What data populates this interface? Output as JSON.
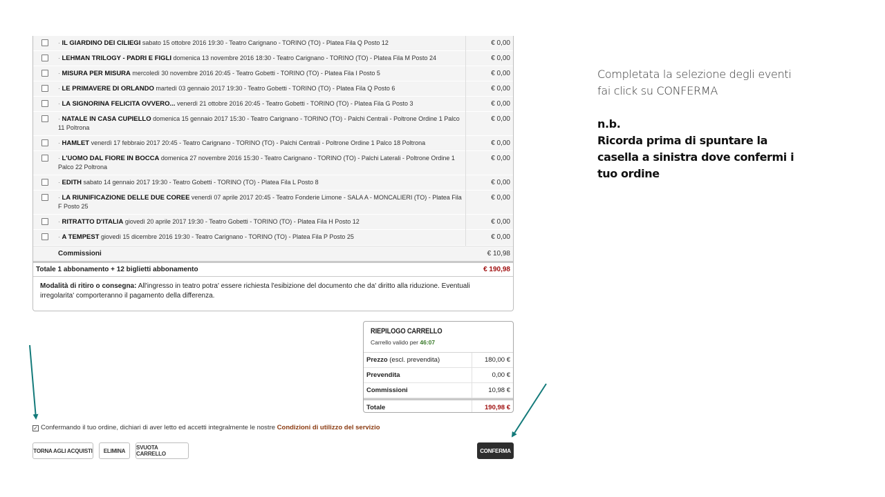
{
  "order": {
    "rows": [
      {
        "title": "IL GIARDINO DEI CILIEGI",
        "detail": "sabato 15 ottobre 2016 19:30 - Teatro Carignano - TORINO (TO) - Platea Fila Q Posto 12",
        "price": "€ 0,00"
      },
      {
        "title": "LEHMAN TRILOGY - PADRI E FIGLI",
        "detail": "domenica 13 novembre 2016 18:30 - Teatro Carignano - TORINO (TO) - Platea Fila M Posto 24",
        "price": "€ 0,00"
      },
      {
        "title": "MISURA PER MISURA",
        "detail": "mercoledì 30 novembre 2016 20:45 - Teatro Gobetti - TORINO (TO) - Platea Fila I Posto 5",
        "price": "€ 0,00"
      },
      {
        "title": "LE PRIMAVERE DI ORLANDO",
        "detail": "martedì 03 gennaio 2017 19:30 - Teatro Gobetti - TORINO (TO) - Platea Fila Q Posto 6",
        "price": "€ 0,00"
      },
      {
        "title": "LA SIGNORINA FELICITA OVVERO...",
        "detail": "venerdì 21 ottobre 2016 20:45 - Teatro Gobetti - TORINO (TO) - Platea Fila G Posto 3",
        "price": "€ 0,00"
      },
      {
        "title": "NATALE IN CASA CUPIELLO",
        "detail": "domenica 15 gennaio 2017 15:30 - Teatro Carignano - TORINO (TO) - Palchi Centrali - Poltrone Ordine 1 Palco 11 Poltrona",
        "price": "€ 0,00"
      },
      {
        "title": "HAMLET",
        "detail": "venerdì 17 febbraio 2017 20:45 - Teatro Carignano - TORINO (TO) - Palchi Centrali - Poltrone Ordine 1 Palco 18 Poltrona",
        "price": "€ 0,00"
      },
      {
        "title": "L'UOMO DAL FIORE IN BOCCA",
        "detail": "domenica 27 novembre 2016 15:30 - Teatro Carignano - TORINO (TO) - Palchi Laterali - Poltrone Ordine 1 Palco 22 Poltrona",
        "price": "€ 0,00"
      },
      {
        "title": "EDITH",
        "detail": "sabato 14 gennaio 2017 19:30 - Teatro Gobetti - TORINO (TO) - Platea Fila L Posto 8",
        "price": "€ 0,00"
      },
      {
        "title": "LA RIUNIFICAZIONE DELLE DUE COREE",
        "detail": "venerdì 07 aprile 2017 20:45 - Teatro Fonderie Limone - SALA A - MONCALIERI (TO) - Platea Fila F Posto 25",
        "price": "€ 0,00"
      },
      {
        "title": "RITRATTO D'ITALIA",
        "detail": "giovedì 20 aprile 2017 19:30 - Teatro Gobetti - TORINO (TO) - Platea Fila H Posto 12",
        "price": "€ 0,00"
      },
      {
        "title": "A TEMPEST",
        "detail": "giovedì 15 dicembre 2016 19:30 - Teatro Carignano - TORINO (TO) - Platea Fila P Posto 25",
        "price": "€ 0,00"
      }
    ],
    "commissions_label": "Commissioni",
    "commissions_value": "€ 10,98",
    "total_label": "Totale 1 abbonamento + 12 biglietti abbonamento",
    "total_value": "€ 190,98",
    "delivery_label": "Modalità di ritiro o consegna:",
    "delivery_text": "All'ingresso in teatro potra' essere richiesta l'esibizione del documento che da' diritto alla riduzione. Eventuali irregolarita' comporteranno il pagamento della differenza."
  },
  "cart": {
    "title": "RIEPILOGO CARRELLO",
    "valid_label": "Carrello valido per",
    "valid_time": "46:07",
    "rows": [
      {
        "label_bold": "Prezzo",
        "label_rest": " (escl. prevendita)",
        "value": "180,00 €"
      },
      {
        "label_bold": "Prevendita",
        "label_rest": "",
        "value": "0,00 €"
      },
      {
        "label_bold": "Commissioni",
        "label_rest": "",
        "value": "10,98 €"
      }
    ],
    "total_label": "Totale",
    "total_value": "190,98 €"
  },
  "terms": {
    "text": "Confermando il tuo ordine, dichiari di aver letto ed accetti integralmente le nostre",
    "link": "Condizioni di utilizzo del servizio",
    "checked": true
  },
  "buttons": {
    "back": "TORNA AGLI ACQUISTI",
    "delete": "ELIMINA",
    "empty": "SVUOTA CARRELLO",
    "confirm": "CONFERMA"
  },
  "notes": {
    "instruction": "Completata la selezione degli eventi fai click su CONFERMA",
    "nb_title": "n.b.",
    "nb_text": "Ricorda prima di spuntare la casella a sinistra dove confermi i tuo ordine"
  },
  "colors": {
    "arrow": "#137a7a",
    "total_red": "#a01010",
    "timer_green": "#3a7a2a",
    "terms_link": "#8a3a10"
  },
  "icons": {
    "row_checkbox": "checkbox-empty-icon",
    "terms_checkbox": "checkbox-checked-icon",
    "arrow": "arrow-pointer-icon"
  }
}
